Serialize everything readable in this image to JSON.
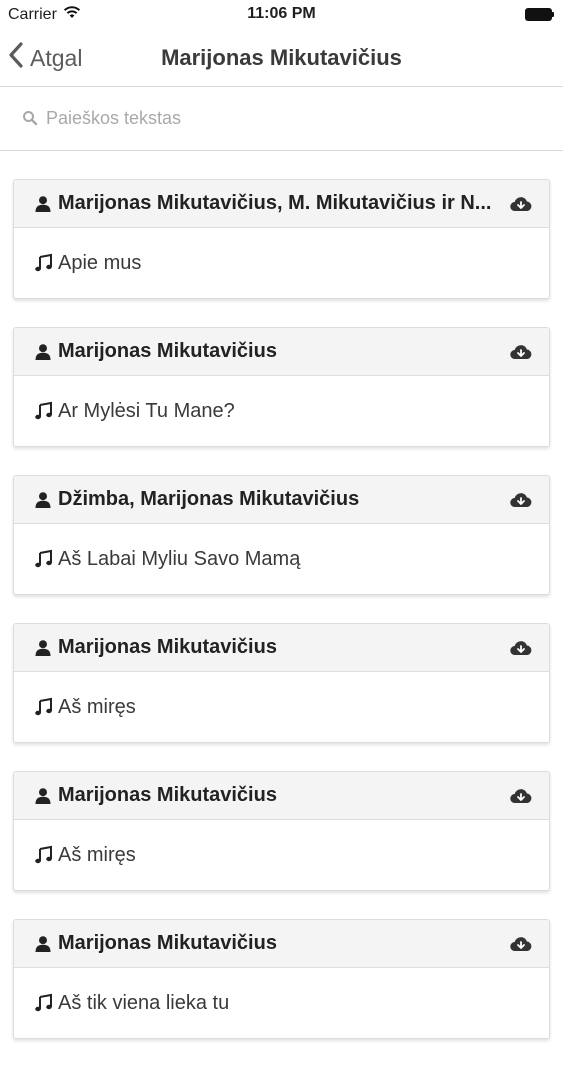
{
  "status_bar": {
    "carrier": "Carrier",
    "time": "11:06 PM",
    "wifi_icon": "wifi-icon",
    "battery_icon": "battery-icon"
  },
  "nav": {
    "back_label": "Atgal",
    "back_icon": "chevron-left-icon",
    "title": "Marijonas Mikutavičius"
  },
  "search": {
    "placeholder": "Paieškos tekstas",
    "value": "",
    "icon": "search-icon"
  },
  "songs": [
    {
      "artist": "Marijonas Mikutavičius, M. Mikutavičius ir N...",
      "title": "Apie mus"
    },
    {
      "artist": "Marijonas Mikutavičius",
      "title": "Ar Mylėsi Tu Mane?"
    },
    {
      "artist": "Džimba, Marijonas Mikutavičius",
      "title": "Aš Labai Myliu Savo Mamą"
    },
    {
      "artist": "Marijonas Mikutavičius",
      "title": "Aš miręs"
    },
    {
      "artist": "Marijonas Mikutavičius",
      "title": "Aš miręs"
    },
    {
      "artist": "Marijonas Mikutavičius",
      "title": "Aš tik viena lieka tu"
    }
  ],
  "icons": {
    "artist": "user-icon",
    "song": "music-note-icon",
    "download": "cloud-download-icon"
  },
  "colors": {
    "card_header_bg": "#f4f4f4",
    "card_border": "#dcdcdc",
    "nav_text": "#5b5b5b",
    "placeholder": "#a8a8a8"
  }
}
